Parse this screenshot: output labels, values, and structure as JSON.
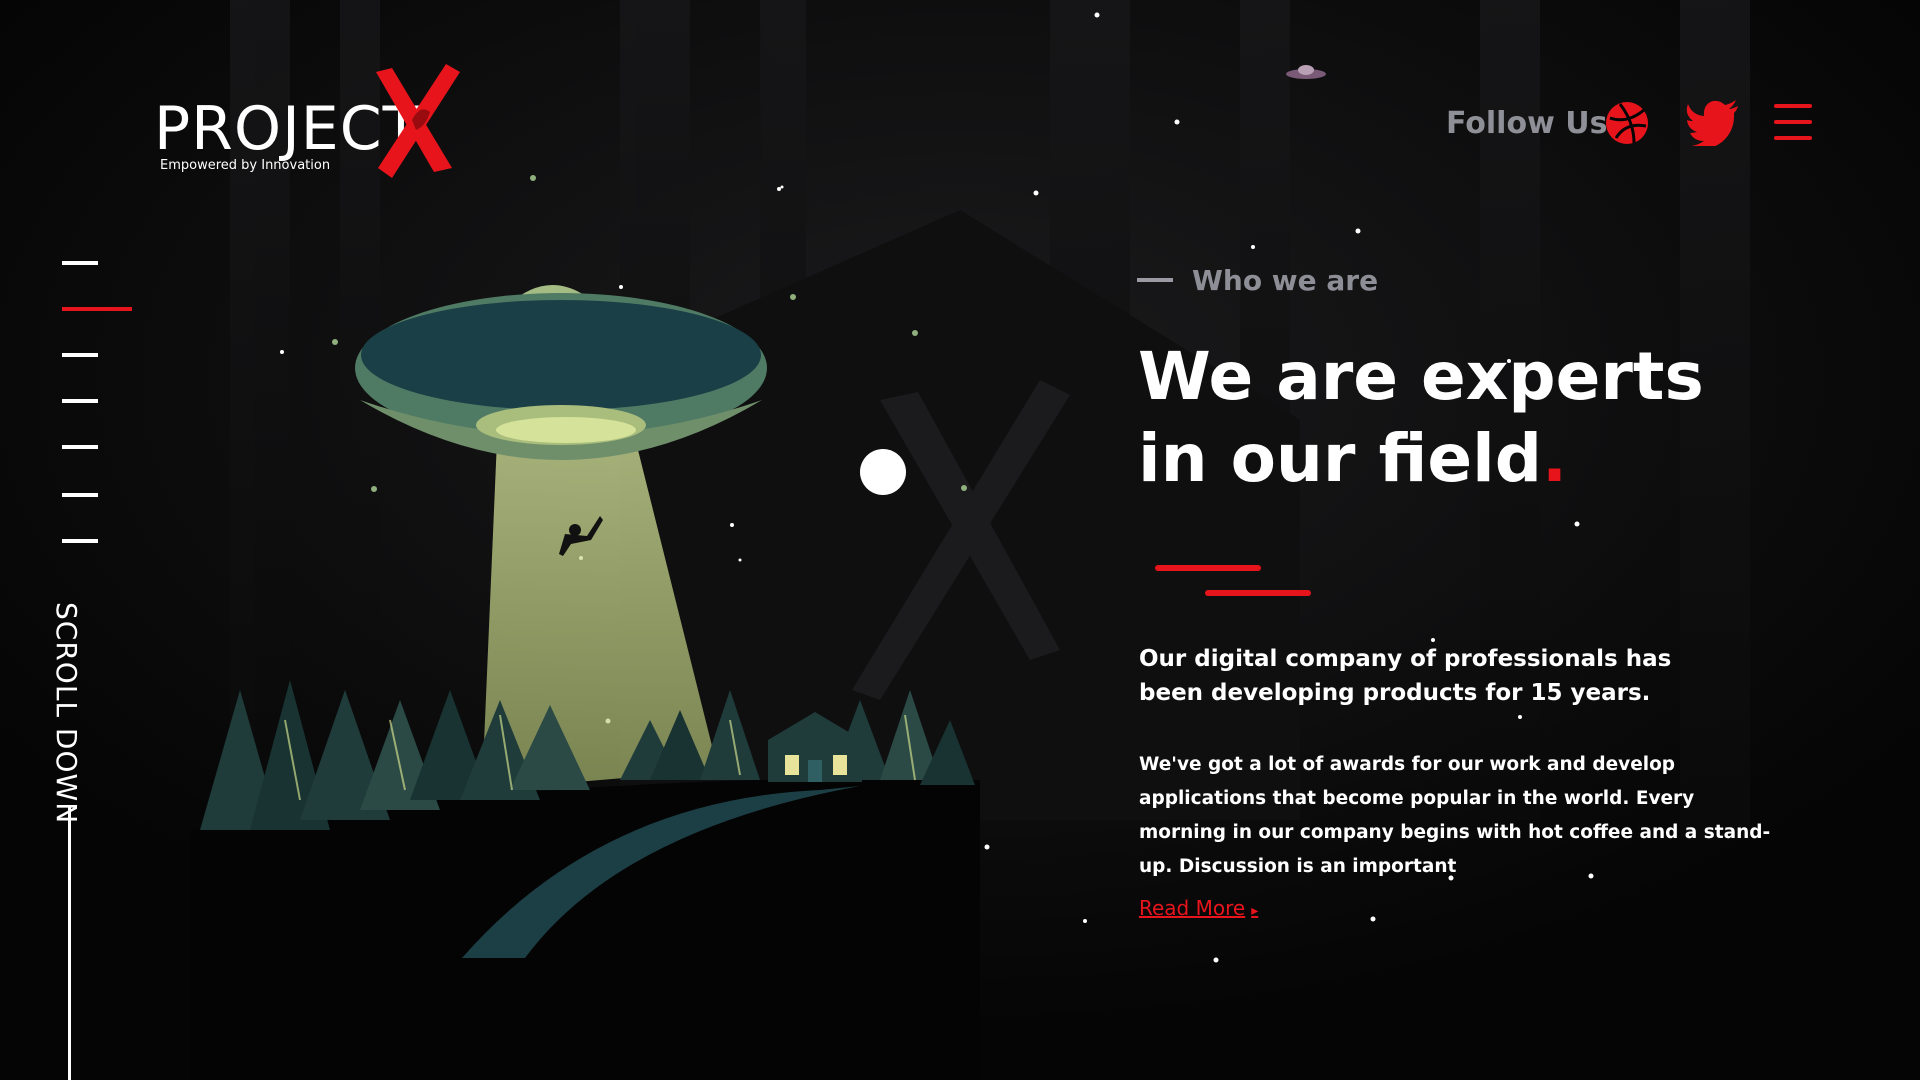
{
  "logo": {
    "wordmark": "PROJECT",
    "tagline": "Empowered by Innovation"
  },
  "header": {
    "follow_label": "Follow Us",
    "social": [
      {
        "name": "dribbble-icon"
      },
      {
        "name": "twitter-icon"
      }
    ],
    "menu_icon": "hamburger-menu-icon"
  },
  "side_nav": {
    "active_index": 1,
    "count": 7,
    "scroll_label": "SCROLL DOWN"
  },
  "section": {
    "eyebrow": "Who we are",
    "headline_line1": "We are experts",
    "headline_line2": "in our field",
    "headline_dot": ".",
    "lead": "Our digital company of professionals has been developing products for 15 years.",
    "body": "We've got a lot of awards for our work and develop applications that become popular in the world. Every morning in our company begins with hot coffee and a stand-up. Discussion is an important",
    "read_more": "Read More"
  },
  "colors": {
    "accent": "#e8141c",
    "background": "#050505",
    "muted_text": "#8e8e96",
    "ufo_green": "#6f8f6a",
    "beam": "#c9d98a",
    "tree_dark": "#1e3c3a"
  }
}
